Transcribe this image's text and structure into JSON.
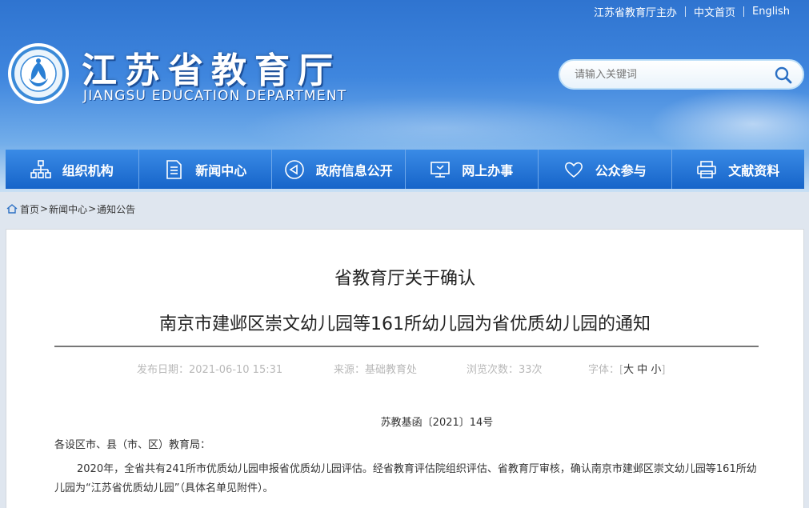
{
  "toplinks": {
    "host": "江苏省教育厅主办",
    "home_cn": "中文首页",
    "english": "English"
  },
  "site": {
    "title": "江苏省教育厅",
    "subtitle": "JIANGSU EDUCATION DEPARTMENT"
  },
  "search": {
    "placeholder": "请输入关键词"
  },
  "nav": {
    "items": [
      {
        "label": "组织机构",
        "icon": "org-chart-icon"
      },
      {
        "label": "新闻中心",
        "icon": "document-icon"
      },
      {
        "label": "政府信息公开",
        "icon": "megaphone-icon"
      },
      {
        "label": "网上办事",
        "icon": "monitor-icon"
      },
      {
        "label": "公众参与",
        "icon": "heart-icon"
      },
      {
        "label": "文献资料",
        "icon": "printer-icon"
      }
    ]
  },
  "breadcrumb": {
    "home": "首页",
    "news": "新闻中心",
    "notice": "通知公告",
    "sep": ">"
  },
  "article": {
    "title_line1": "省教育厅关于确认",
    "title_line2": "南京市建邺区崇文幼儿园等161所幼儿园为省优质幼儿园的通知",
    "publish_date": "发布日期：2021-06-10 15:31",
    "source": "来源：基础教育处",
    "views": "浏览次数：33次",
    "font_label": "字体：[",
    "font_large": "大",
    "font_medium": "中",
    "font_small": "小",
    "font_close": "]",
    "doc_number": "苏教基函〔2021〕14号",
    "salutation": "各设区市、县（市、区）教育局：",
    "paragraph1": "2020年，全省共有241所市优质幼儿园申报省优质幼儿园评估。经省教育评估院组织评估、省教育厅审核，确认南京市建邺区崇文幼儿园等161所幼儿园为“江苏省优质幼儿园”（具体名单见附件）。"
  },
  "colors": {
    "header_blue": "#2f74d0",
    "nav_blue": "#1e6fd2"
  }
}
